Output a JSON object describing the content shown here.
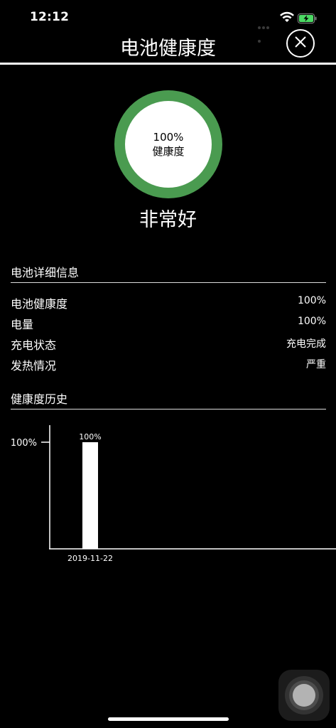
{
  "status_bar": {
    "time": "12:12"
  },
  "header": {
    "title": "电池健康度"
  },
  "summary": {
    "percent": "100%",
    "label": "健康度",
    "health_fraction": 1.0,
    "rating": "非常好",
    "ring_color": "#4a9b50"
  },
  "details": {
    "title": "电池详细信息",
    "rows": [
      {
        "label": "电池健康度",
        "value": "100%"
      },
      {
        "label": "电量",
        "value": "100%"
      },
      {
        "label": "充电状态",
        "value": "充电完成"
      },
      {
        "label": "发热情况",
        "value": "严重"
      }
    ]
  },
  "history": {
    "title": "健康度历史"
  },
  "chart_data": {
    "type": "bar",
    "categories": [
      "2019-11-22"
    ],
    "values": [
      100
    ],
    "data_labels": [
      "100%"
    ],
    "y_ticks": [
      {
        "value": 100,
        "label": "100%"
      }
    ],
    "ylim": [
      0,
      100
    ],
    "grid": false,
    "bar_color": "#ffffff"
  }
}
